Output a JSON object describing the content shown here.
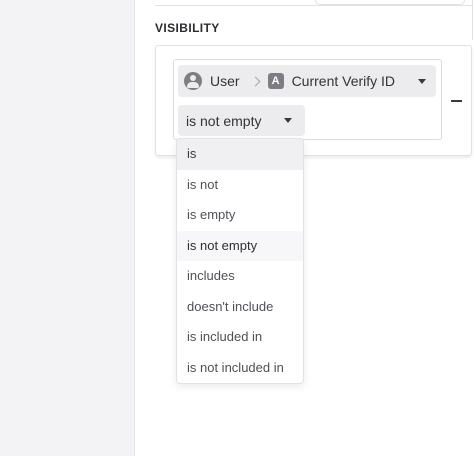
{
  "section": {
    "title": "VISIBILITY"
  },
  "condition": {
    "path_root": "User",
    "field_type_glyph": "A",
    "field_name": "Current Verify ID",
    "operator": "is not empty"
  },
  "operator_options": [
    {
      "label": "is",
      "state": "hover"
    },
    {
      "label": "is not",
      "state": ""
    },
    {
      "label": "is empty",
      "state": ""
    },
    {
      "label": "is not empty",
      "state": "selected"
    },
    {
      "label": "includes",
      "state": ""
    },
    {
      "label": "doesn't include",
      "state": ""
    },
    {
      "label": "is included in",
      "state": ""
    },
    {
      "label": "is not included in",
      "state": ""
    }
  ]
}
